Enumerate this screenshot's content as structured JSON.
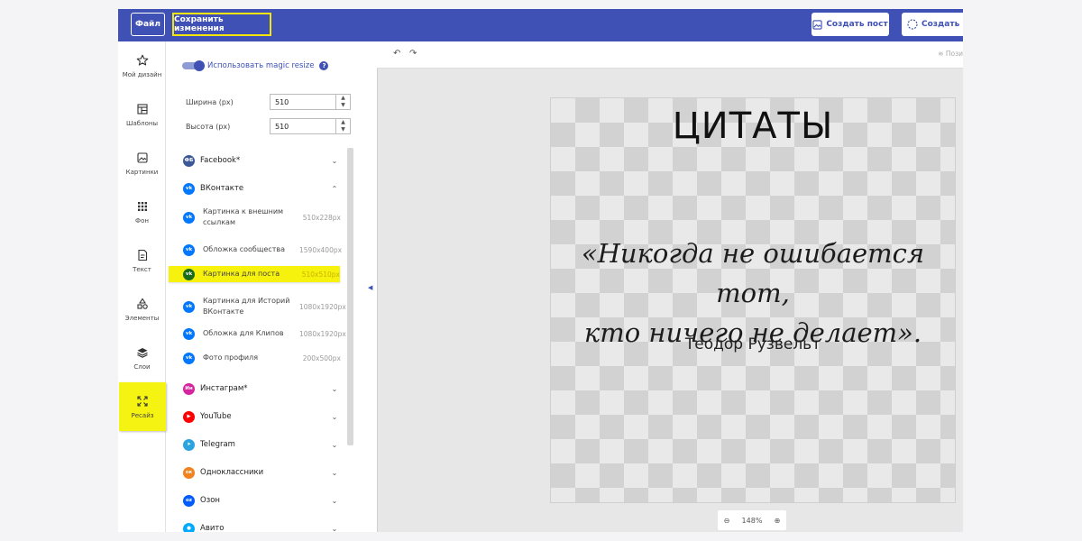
{
  "topbar": {
    "file_label": "Файл",
    "save_label": "Сохранить изменения",
    "create_post_label": "Создать пост",
    "create_ig_label": "Создать Ис"
  },
  "rail": {
    "items": [
      {
        "label": "Мой дизайн",
        "icon": "star-icon"
      },
      {
        "label": "Шаблоны",
        "icon": "templates-icon"
      },
      {
        "label": "Картинки",
        "icon": "image-icon"
      },
      {
        "label": "Фон",
        "icon": "grid-dots-icon"
      },
      {
        "label": "Текст",
        "icon": "text-doc-icon"
      },
      {
        "label": "Элементы",
        "icon": "shapes-icon"
      },
      {
        "label": "Слои",
        "icon": "layers-icon"
      },
      {
        "label": "Ресайз",
        "icon": "resize-icon"
      }
    ],
    "active_color": "#f5f312"
  },
  "panel": {
    "magic_resize_label": "Использовать magic resize",
    "help_glyph": "?",
    "width_label": "Ширина (px)",
    "width_value": "510",
    "height_label": "Высота (px)",
    "height_value": "510",
    "networks": [
      {
        "name": "Facebook*",
        "badge": "ФБ",
        "color": "#3b5998",
        "state": "collapsed"
      },
      {
        "name": "ВКонтакте",
        "badge": "vk",
        "color": "#0077ff",
        "state": "expanded"
      },
      {
        "name": "Инстаграм*",
        "badge": "Ин",
        "color": "#d6249f",
        "state": "collapsed"
      },
      {
        "name": "YouTube",
        "badge": "▶",
        "color": "#ff0000",
        "state": "collapsed"
      },
      {
        "name": "Telegram",
        "badge": "➤",
        "color": "#2aa3df",
        "state": "collapsed"
      },
      {
        "name": "Одноклассники",
        "badge": "ок",
        "color": "#f2821e",
        "state": "collapsed"
      },
      {
        "name": "Озон",
        "badge": "oz",
        "color": "#005bff",
        "state": "collapsed"
      },
      {
        "name": "Авито",
        "badge": "●",
        "color": "#00aaff",
        "state": "collapsed"
      }
    ],
    "vk_formats": [
      {
        "name": "Картинка к внешним ссылкам",
        "size": "510x228px"
      },
      {
        "name": "Обложка сообщества",
        "size": "1590x400px"
      },
      {
        "name": "Картинка для поста",
        "size": "510x510px",
        "selected": true
      },
      {
        "name": "Картинка для Историй ВКонтакте",
        "size": "1080x1920px"
      },
      {
        "name": "Обложка для Клипов",
        "size": "1080x1920px"
      },
      {
        "name": "Фото профиля",
        "size": "200x500px"
      }
    ]
  },
  "workspace": {
    "undo_glyph": "↶",
    "redo_glyph": "↷",
    "positions_label": "Пози",
    "zoom_level": "148%"
  },
  "artboard": {
    "title": "ЦИТАТЫ",
    "quote_line1": "«Никогда не ошибается тот,",
    "quote_line2": "кто ничего не делает».",
    "author": "Теодор Рузвельт"
  }
}
